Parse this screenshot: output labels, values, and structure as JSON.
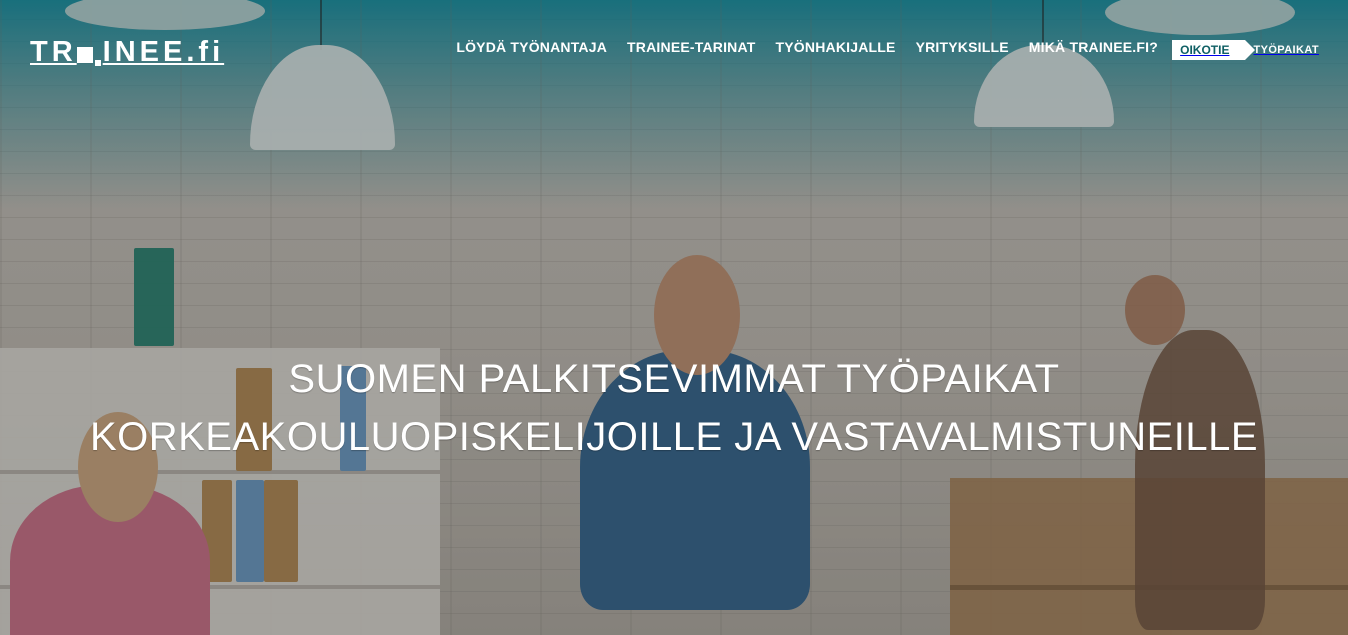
{
  "logo": {
    "text_part1": "TR",
    "text_part2": "INEE.fi"
  },
  "nav": {
    "items": [
      {
        "label": "LÖYDÄ TYÖNANTAJA"
      },
      {
        "label": "TRAINEE-TARINAT"
      },
      {
        "label": "TYÖNHAKIJALLE"
      },
      {
        "label": "YRITYKSILLE"
      },
      {
        "label": "MIKÄ TRAINEE.FI?"
      }
    ]
  },
  "badge": {
    "oikotie": "OIKOTIE",
    "tyopaikat": "TYÖPAIKAT"
  },
  "hero": {
    "line1": "SUOMEN PALKITSEVIMMAT TYÖPAIKAT",
    "line2": "KORKEAKOULUOPISKELIJOILLE JA VASTAVALMISTUNEILLE"
  },
  "colors": {
    "teal": "#1aa0b0",
    "white": "#ffffff"
  }
}
